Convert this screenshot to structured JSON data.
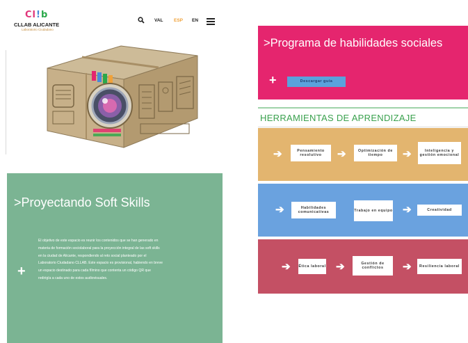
{
  "header": {
    "logo_mark": [
      "Cl",
      "!",
      "b"
    ],
    "logo_title": "CLLAB ALICANTE",
    "logo_subtitle": "Laboratorio Ciudadano",
    "nav": {
      "val": "VAL",
      "esp": "ESP",
      "en": "EN"
    },
    "accent_active": "#f0a23a"
  },
  "soft_skills": {
    "title": ">Proyectando Soft Skills",
    "plus": "+",
    "description": "El objetivo de este espacio es reunir los contenidos que se han generado en materia de formación sociolaboral para la proyección integral de las soft skills en la ciudad de Alicante, respondiendo al reto social planteado por el Laboratorio Ciudadano CLLAB. Este espacio es provisional, habiendo en breve un espacio destinado para cada fílmino que contenta un código QR que redirigía a cada uno de estos audiovisuales.",
    "bg_color": "#7bb493"
  },
  "program": {
    "title": ">Programa de habilidades sociales",
    "plus": "+",
    "download_label": "Descargar guía",
    "bg_color": "#e5256e"
  },
  "tools": {
    "title": "HERRAMIENTAS DE APRENDIZAJE",
    "rows": [
      {
        "color": "#e3b56f",
        "items": [
          "Pensamiento resolutivo",
          "Optimización de tiempo",
          "Inteligencia y gestión emocional"
        ]
      },
      {
        "color": "#6aa2df",
        "items": [
          "Habilidades comunicativas",
          "Trabajo en equipo",
          "Creatividad"
        ]
      },
      {
        "color": "#c45064",
        "items": [
          "Ética laboral",
          "Gestión de conflictos",
          "Resiliencia laboral"
        ]
      }
    ]
  }
}
